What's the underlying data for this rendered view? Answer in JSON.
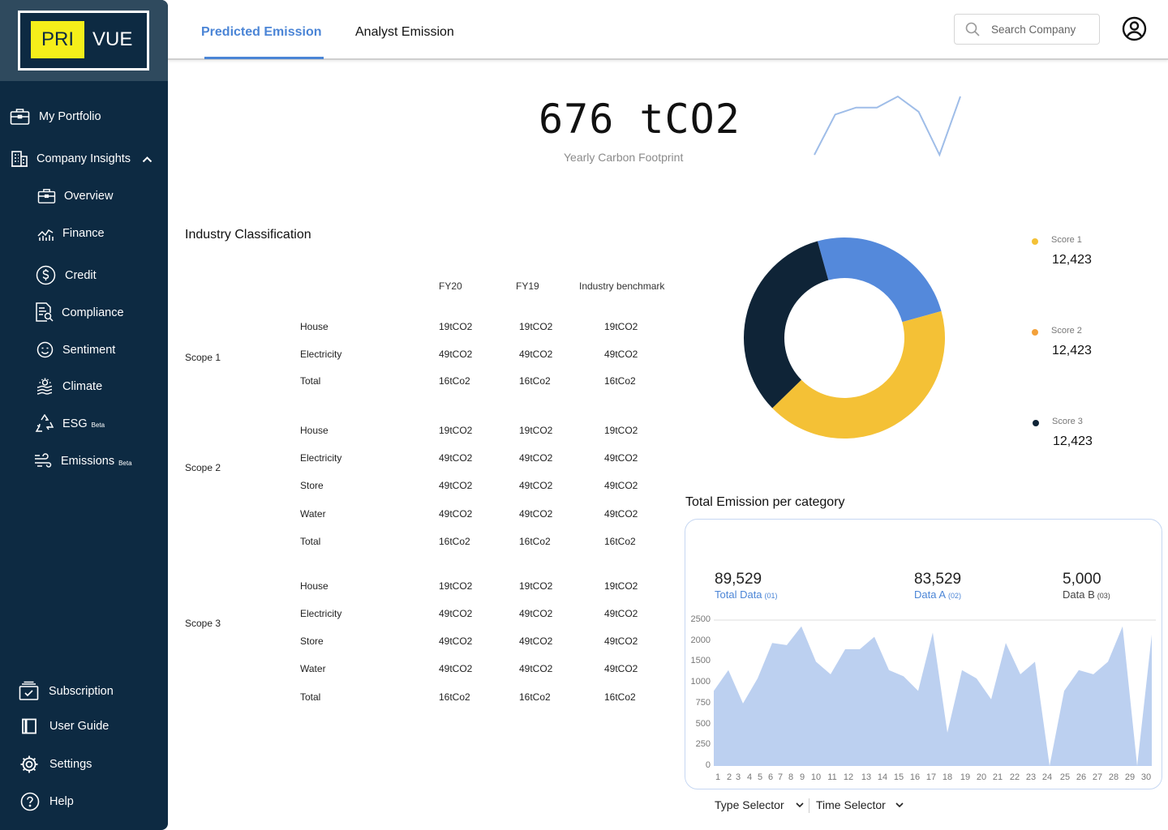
{
  "brand": {
    "logo_left": "PRI",
    "logo_right": "VUE"
  },
  "sidebar": {
    "portfolio": "My Portfolio",
    "insights": "Company Insights",
    "items": [
      {
        "label": "Overview",
        "beta": ""
      },
      {
        "label": "Finance",
        "beta": ""
      },
      {
        "label": "Credit",
        "beta": ""
      },
      {
        "label": "Compliance",
        "beta": ""
      },
      {
        "label": "Sentiment",
        "beta": ""
      },
      {
        "label": "Climate",
        "beta": ""
      },
      {
        "label": "ESG",
        "beta": "Beta"
      },
      {
        "label": "Emissions",
        "beta": "Beta"
      }
    ],
    "bottom": [
      "Subscription",
      "User Guide",
      "Settings",
      "Help"
    ]
  },
  "tabs": {
    "predicted": "Predicted Emission",
    "analyst": "Analyst Emission"
  },
  "search": {
    "placeholder": "Search Company"
  },
  "headline": {
    "value": "676 tCO2",
    "caption": "Yearly Carbon Footprint"
  },
  "industry": {
    "title": "Industry Classification",
    "headers": [
      "FY20",
      "FY19",
      "Industry benchmark"
    ],
    "scopes": [
      {
        "name": "Scope 1",
        "rows": [
          {
            "item": "House",
            "fy20": "19tCO2",
            "fy19": "19tCO2",
            "bench": "19tCO2"
          },
          {
            "item": "Electricity",
            "fy20": "49tCO2",
            "fy19": "49tCO2",
            "bench": "49tCO2"
          },
          {
            "item": "Total",
            "fy20": "16tCo2",
            "fy19": "16tCo2",
            "bench": "16tCo2"
          }
        ]
      },
      {
        "name": "Scope 2",
        "rows": [
          {
            "item": "House",
            "fy20": "19tCO2",
            "fy19": "19tCO2",
            "bench": "19tCO2"
          },
          {
            "item": "Electricity",
            "fy20": "49tCO2",
            "fy19": "49tCO2",
            "bench": "49tCO2"
          },
          {
            "item": "Store",
            "fy20": "49tCO2",
            "fy19": "49tCO2",
            "bench": "49tCO2"
          },
          {
            "item": "Water",
            "fy20": "49tCO2",
            "fy19": "49tCO2",
            "bench": "49tCO2"
          },
          {
            "item": "Total",
            "fy20": "16tCo2",
            "fy19": "16tCo2",
            "bench": "16tCo2"
          }
        ]
      },
      {
        "name": "Scope 3",
        "rows": [
          {
            "item": "House",
            "fy20": "19tCO2",
            "fy19": "19tCO2",
            "bench": "19tCO2"
          },
          {
            "item": "Electricity",
            "fy20": "49tCO2",
            "fy19": "49tCO2",
            "bench": "49tCO2"
          },
          {
            "item": "Store",
            "fy20": "49tCO2",
            "fy19": "49tCO2",
            "bench": "49tCO2"
          },
          {
            "item": "Water",
            "fy20": "49tCO2",
            "fy19": "49tCO2",
            "bench": "49tCO2"
          },
          {
            "item": "Total",
            "fy20": "16tCo2",
            "fy19": "16tCo2",
            "bench": "16tCo2"
          }
        ]
      }
    ]
  },
  "score_legend": [
    {
      "label": "Score 1",
      "value": "12,423",
      "color": "#f4c136"
    },
    {
      "label": "Score 2",
      "value": "12,423",
      "color": "#f3a13a"
    },
    {
      "label": "Score 3",
      "value": "12,423",
      "color": "#0f2437"
    }
  ],
  "emission_category": {
    "title": "Total Emission per category",
    "kpis": [
      {
        "value": "89,529",
        "label": "Total Data",
        "code": "(01)",
        "color": "#4b85d6"
      },
      {
        "value": "83,529",
        "label": "Data A",
        "code": "(02)",
        "color": "#4b85d6"
      },
      {
        "value": "5,000",
        "label": "Data B",
        "code": "(03)",
        "color": "#444444"
      }
    ],
    "type_selector": "Type Selector",
    "time_selector": "Time Selector"
  },
  "colors": {
    "sidebar": "#0d2a42",
    "accent": "#4b85d6",
    "logo_yellow": "#f5ee1a",
    "area_fill": "#bcd0f0"
  },
  "chart_data": [
    {
      "type": "line",
      "title": "",
      "x": [
        1,
        2,
        3,
        4,
        5,
        6,
        7,
        8
      ],
      "values": [
        0,
        29,
        34,
        34,
        42,
        31,
        0,
        42
      ],
      "xlabel": "",
      "ylabel": "",
      "axes": "hidden",
      "color": "#9fbde8"
    },
    {
      "type": "pie",
      "donut": true,
      "title": "",
      "slices": [
        {
          "label": "blue",
          "value": 25,
          "color": "#5489db"
        },
        {
          "label": "yellow",
          "value": 42,
          "color": "#f4c136"
        },
        {
          "label": "navy",
          "value": 33,
          "color": "#0f2437"
        }
      ]
    },
    {
      "type": "area",
      "title": "",
      "x": [
        1,
        2,
        3,
        4,
        5,
        6,
        7,
        8,
        9,
        10,
        11,
        12,
        13,
        14,
        15,
        16,
        17,
        18,
        19,
        20,
        21,
        22,
        23,
        24,
        25,
        26,
        27,
        28,
        29,
        30
      ],
      "values": [
        900,
        1300,
        750,
        1100,
        1950,
        1900,
        2350,
        1500,
        1200,
        1800,
        1800,
        2100,
        1300,
        1150,
        900,
        2200,
        400,
        1300,
        1100,
        800,
        1950,
        1200,
        1500,
        0,
        900,
        1300,
        1200,
        1500,
        2350,
        0,
        2150
      ],
      "yticks": [
        0,
        250,
        500,
        750,
        1000,
        1500,
        2000,
        2500
      ],
      "ylim": [
        0,
        2500
      ],
      "grid": "top line only",
      "color": "#bcd0f0"
    }
  ]
}
